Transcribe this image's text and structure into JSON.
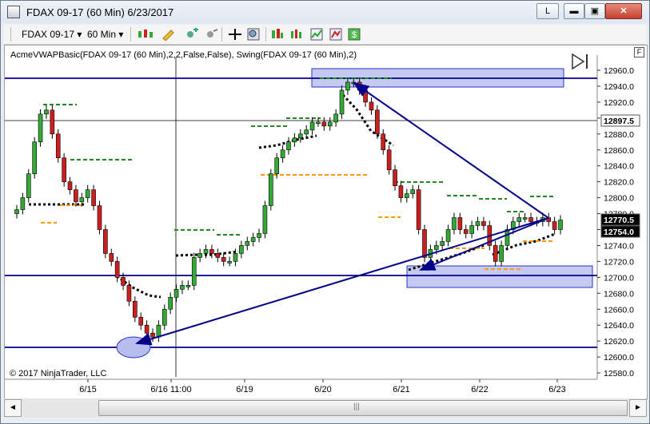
{
  "window": {
    "title": "FDAX 09-17 (60 Min)  6/23/2017",
    "buttons": {
      "help": "L",
      "minimize": "▬",
      "maximize": "▣",
      "close": "✕"
    }
  },
  "toolbar": {
    "instrument": "FDAX 09-17",
    "interval": "60 Min"
  },
  "chart": {
    "indicator_label": "AcmeVWAPBasic(FDAX 09-17 (60 Min),2,2,False,False), Swing(FDAX 09-17 (60 Min),2)",
    "panel_button": "F",
    "copyright": "© 2017 NinjaTrader, LLC",
    "price_ticks": [
      "12960.0",
      "12940.0",
      "12920.0",
      "12900.0",
      "12880.0",
      "12860.0",
      "12840.0",
      "12820.0",
      "12800.0",
      "12780.0",
      "12760.0",
      "12740.0",
      "12720.0",
      "12700.0",
      "12680.0",
      "12660.0",
      "12640.0",
      "12620.0",
      "12600.0",
      "12580.0"
    ],
    "time_labels": [
      "6/15",
      "6/16 11:00",
      "6/19",
      "6/20",
      "6/21",
      "6/22",
      "6/23"
    ],
    "price_markers": {
      "crosshair": "12897.5",
      "last": "12770.5",
      "other": "12754.0"
    },
    "colors": {
      "up": "#33aa33",
      "down": "#cc2020",
      "line": "#00008b",
      "zone_fill": "#b8bdf0",
      "zone_stroke": "#2a36c8",
      "vwap": "#000000",
      "swing_high": "#228822",
      "swing_low": "#ff9900"
    }
  },
  "scrollbar": {
    "left_arrow": "◄",
    "right_arrow": "►",
    "thumb_grip": "|||"
  }
}
